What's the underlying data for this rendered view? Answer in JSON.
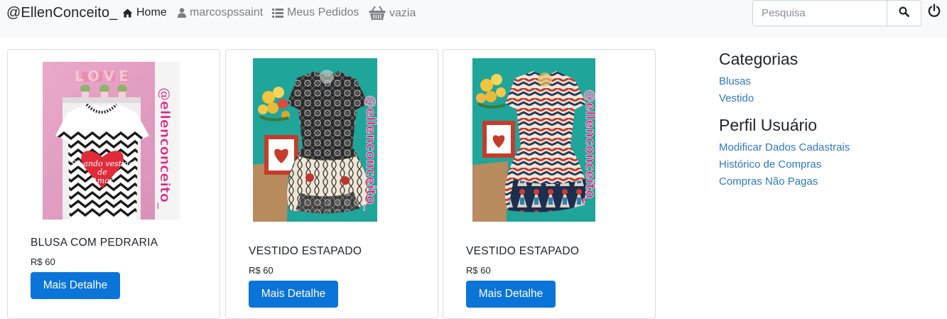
{
  "navbar": {
    "brand": "@EllenConceito_",
    "home_label": "Home",
    "user_label": "marcospssaint",
    "orders_label": "Meus Pedidos",
    "cart_label": "vazia",
    "search_placeholder": "Pesquisa"
  },
  "products": [
    {
      "title": "BLUSA COM PEDRARIA",
      "price": "R$ 60",
      "button": "Mais Detalhe",
      "watermark": "@ellenconceito_",
      "shirt_text": "Só ando vestido de Amor"
    },
    {
      "title": "VESTIDO ESTAPADO",
      "price": "R$ 60",
      "button": "Mais Detalhe",
      "watermark": "@ellenconceito_"
    },
    {
      "title": "VESTIDO ESTAPADO",
      "price": "R$ 60",
      "button": "Mais Detalhe",
      "watermark": "@ellenconceito_"
    }
  ],
  "sidebar": {
    "categories_title": "Categorias",
    "categories": [
      "Blusas",
      "Vestido"
    ],
    "profile_title": "Perfil Usuário",
    "profile_links": [
      "Modificar Dados Cadastrais",
      "Histórico de Compras",
      "Compras Não Pagas"
    ]
  },
  "colors": {
    "button": "#0b74d8",
    "link": "#2f78c4",
    "navbar_bg": "#f8f9fa"
  },
  "icons": [
    "home-icon",
    "user-icon",
    "list-icon",
    "basket-icon",
    "search-icon",
    "power-icon"
  ]
}
